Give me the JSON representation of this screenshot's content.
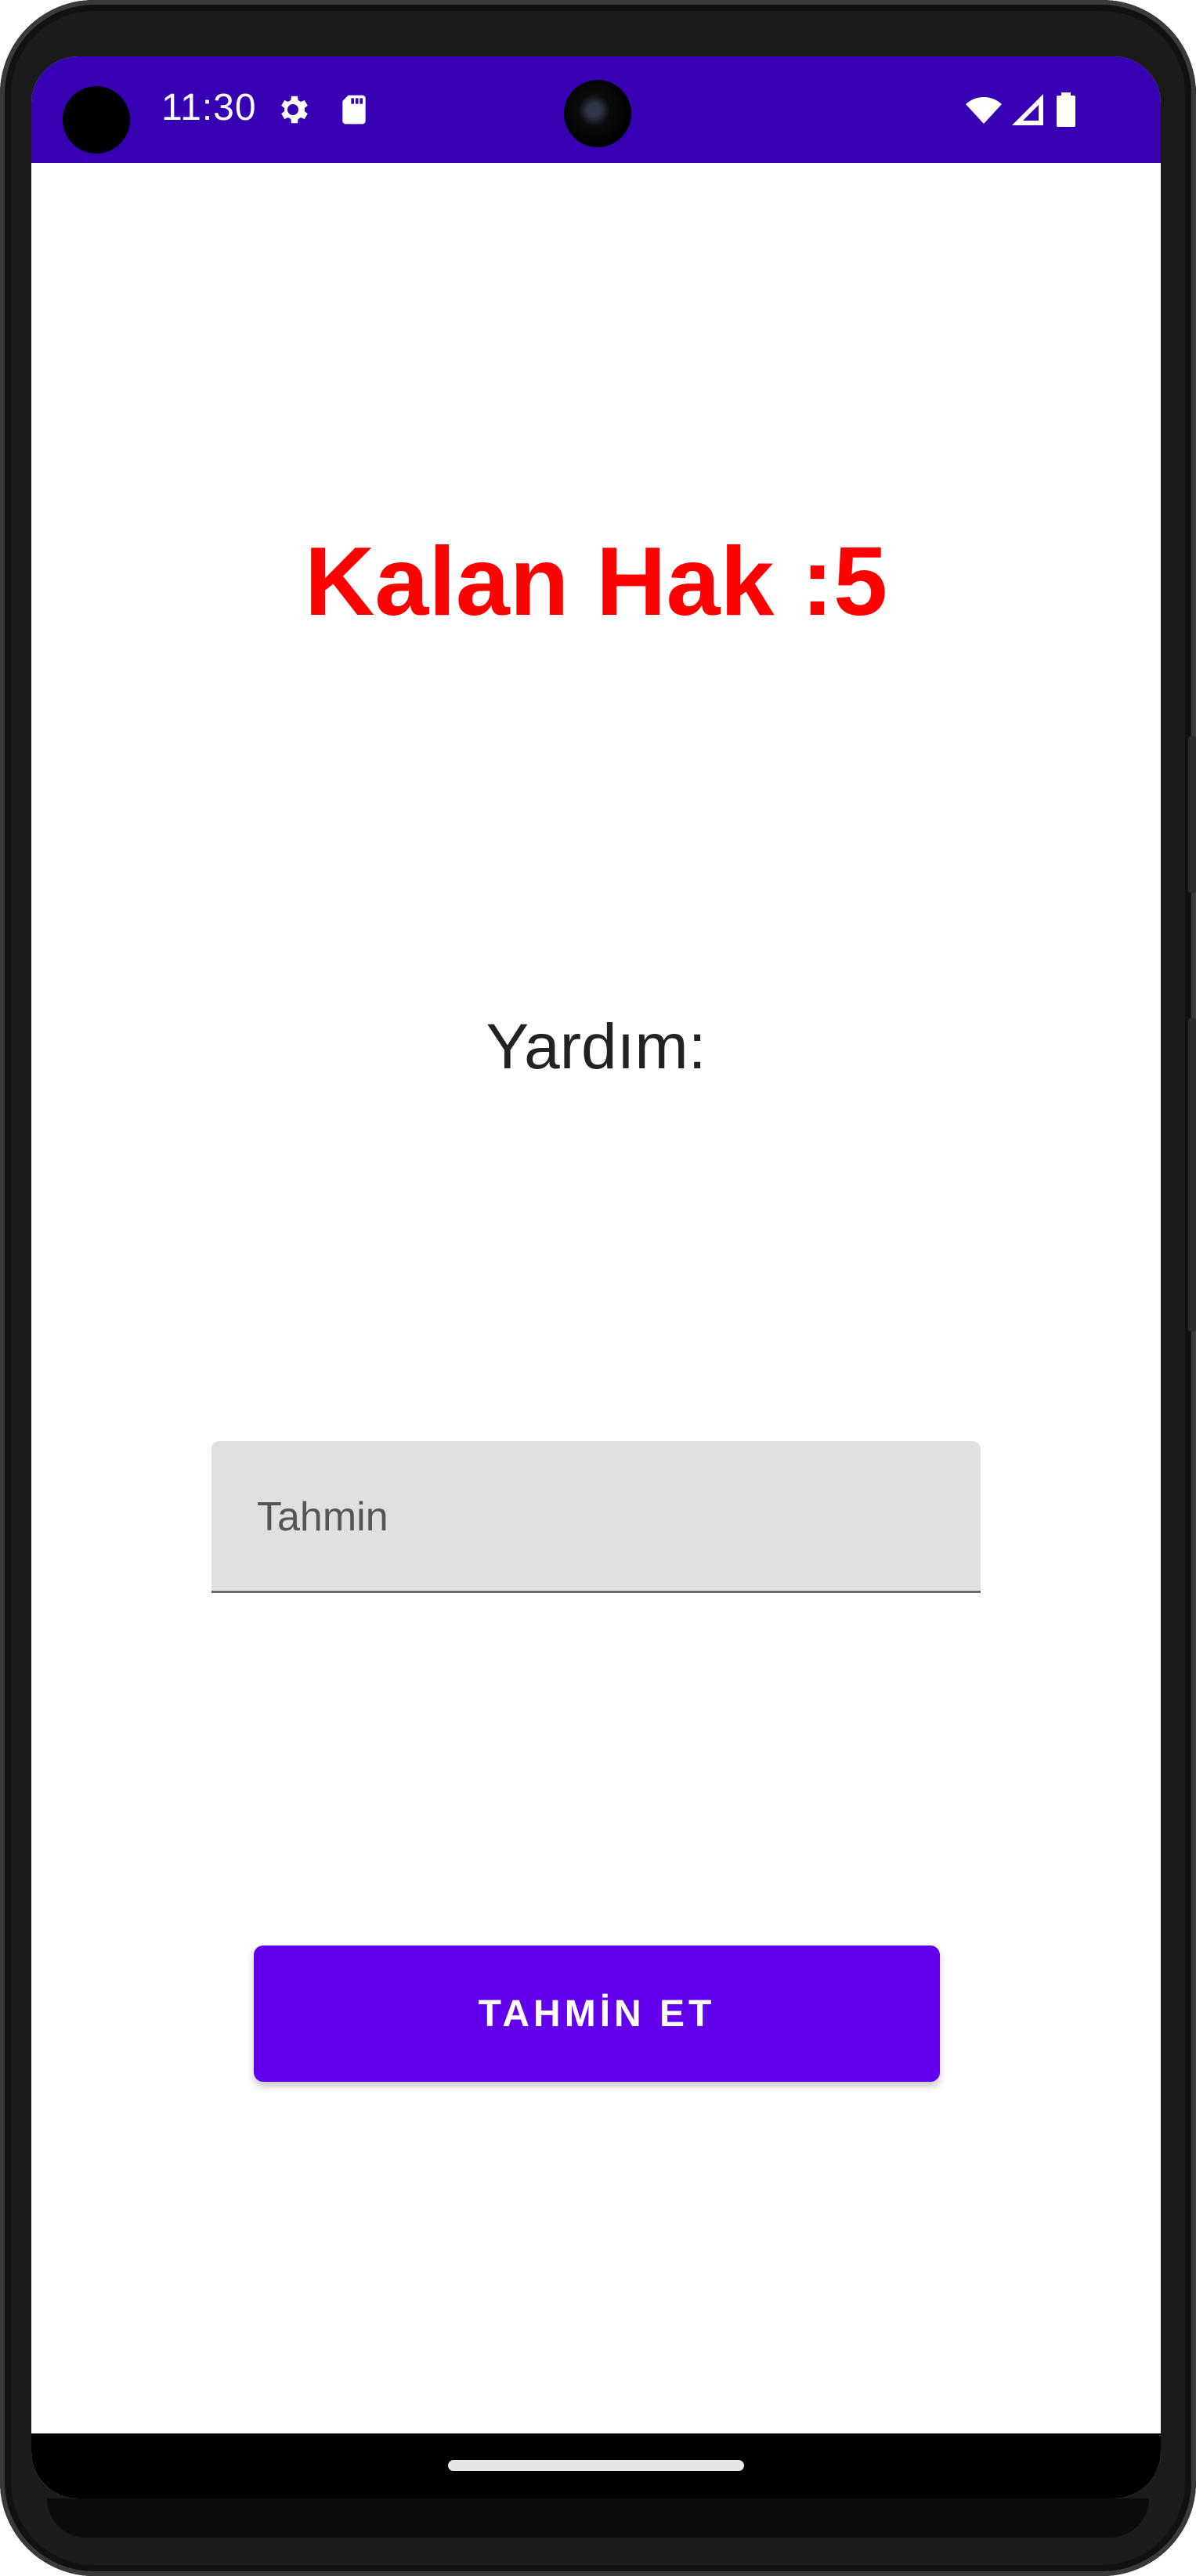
{
  "status_bar": {
    "time": "11:30",
    "background_color": "#3700b3",
    "left_icons": [
      "settings-gear-icon",
      "sd-card-icon"
    ],
    "right_icons": [
      "wifi-icon",
      "signal-icon",
      "battery-icon"
    ]
  },
  "main": {
    "remaining_label": "Kalan Hak :5",
    "remaining_color": "#ff0000",
    "hint_label": "Yardım:",
    "guess_input": {
      "value": "",
      "placeholder": "Tahmin"
    },
    "guess_button_label": "TAHMİN ET",
    "accent_color": "#6200ee"
  }
}
